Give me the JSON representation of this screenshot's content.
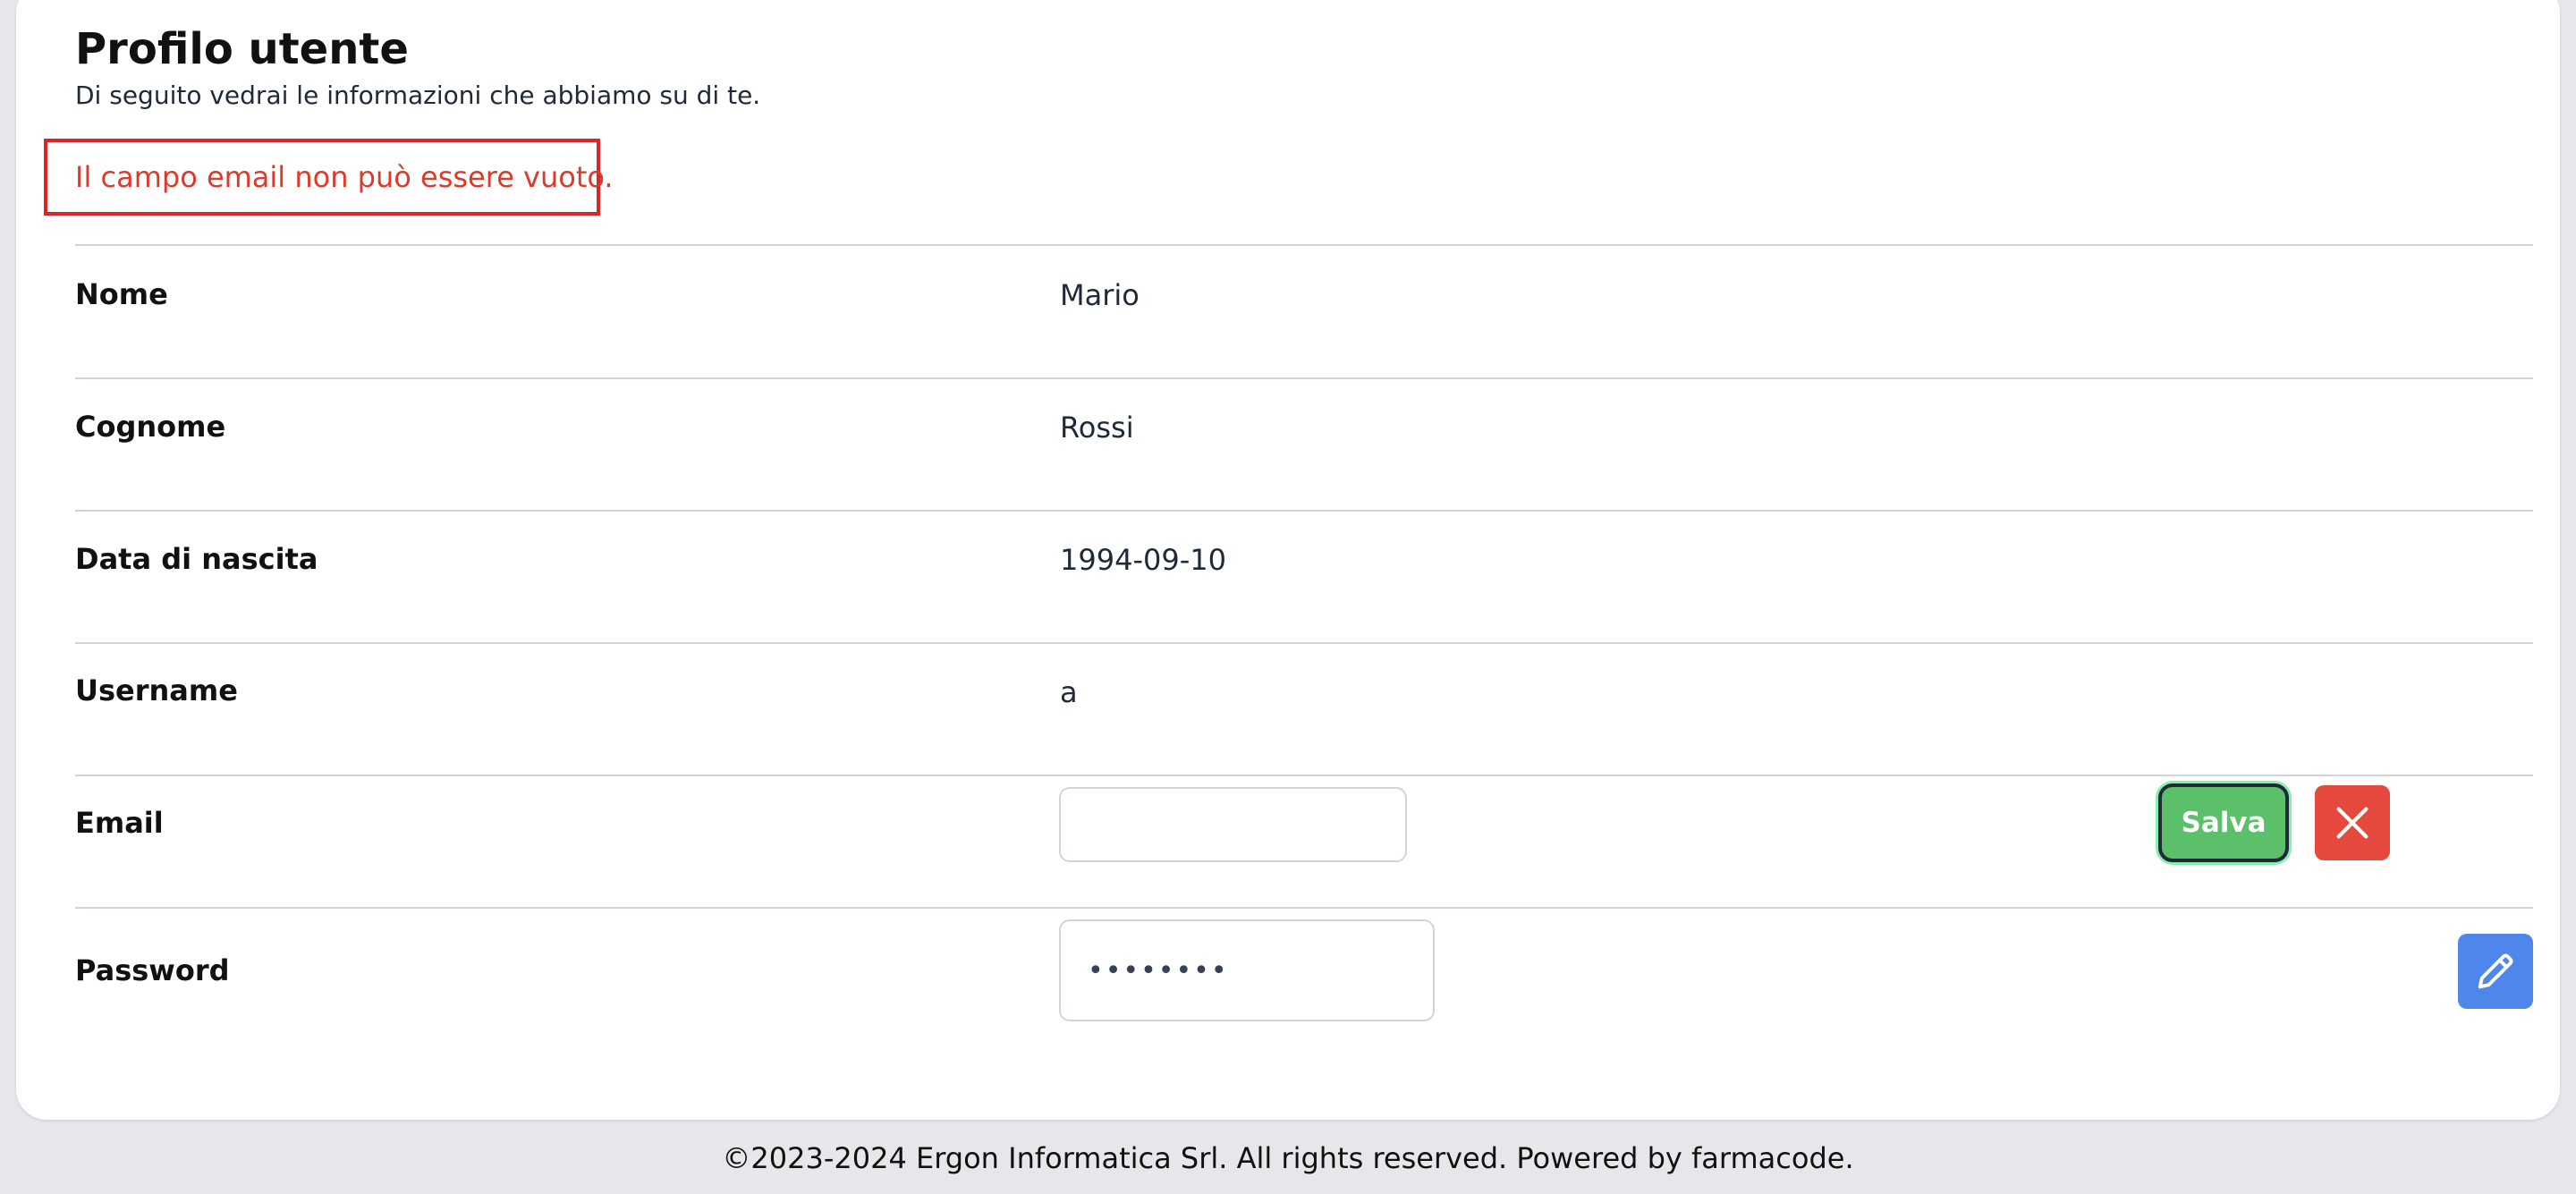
{
  "profile": {
    "title": "Profilo utente",
    "subtitle": "Di seguito vedrai le informazioni che abbiamo su di te.",
    "error_message": "Il campo email non può essere vuoto."
  },
  "fields": {
    "nome": {
      "label": "Nome",
      "value": "Mario"
    },
    "cognome": {
      "label": "Cognome",
      "value": "Rossi"
    },
    "data_nascita": {
      "label": "Data di nascita",
      "value": "1994-09-10"
    },
    "username": {
      "label": "Username",
      "value": "a"
    },
    "email": {
      "label": "Email",
      "value": "",
      "placeholder": ""
    },
    "password": {
      "label": "Password",
      "value": "••••••••"
    }
  },
  "actions": {
    "save_label": "Salva",
    "cancel_icon": "close-icon",
    "edit_icon": "pencil-icon"
  },
  "colors": {
    "save": "#5cbf6a",
    "cancel": "#e5483c",
    "edit": "#4f86ea",
    "error": "#dc3a2b"
  },
  "footer": {
    "text": "©2023-2024 Ergon Informatica Srl. All rights reserved. Powered by farmacode."
  }
}
